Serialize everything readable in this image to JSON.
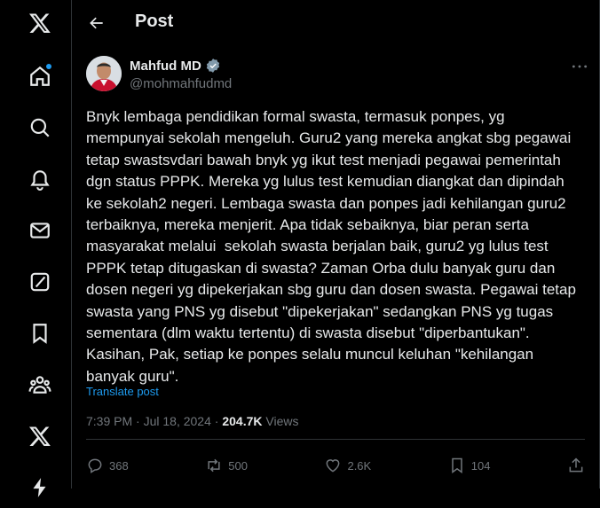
{
  "header": {
    "title": "Post"
  },
  "nav": [
    {
      "name": "x-logo-icon"
    },
    {
      "name": "home-icon"
    },
    {
      "name": "explore-icon"
    },
    {
      "name": "notifications-icon"
    },
    {
      "name": "messages-icon"
    },
    {
      "name": "grok-icon"
    },
    {
      "name": "bookmarks-icon"
    },
    {
      "name": "communities-icon"
    },
    {
      "name": "premium-icon"
    },
    {
      "name": "verified-orgs-icon"
    }
  ],
  "post": {
    "author_name": "Mahfud MD",
    "author_handle": "@mohmahfudmd",
    "text": "Bnyk lembaga pendidikan formal swasta, termasuk ponpes, yg mempunyai sekolah mengeluh. Guru2 yang mereka angkat sbg pegawai tetap swastsvdari bawah bnyk yg ikut test menjadi pegawai pemerintah dgn status PPPK. Mereka yg lulus test kemudian diangkat dan dipindah ke sekolah2 negeri. Lembaga swasta dan ponpes jadi kehilangan guru2 terbaiknya, mereka menjerit. Apa tidak sebaiknya, biar peran serta masyarakat melalui  sekolah swasta berjalan baik, guru2 yg lulus test PPPK tetap ditugaskan di swasta? Zaman Orba dulu banyak guru dan dosen negeri yg dipekerjakan sbg guru dan dosen swasta. Pegawai tetap swasta yang PNS yg disebut \"dipekerjakan\" sedangkan PNS yg tugas sementara (dlm waktu tertentu) di swasta disebut \"diperbantukan\". Kasihan, Pak, setiap ke ponpes selalu muncul keluhan \"kehilangan banyak guru\".",
    "translate_label": "Translate post",
    "time": "7:39 PM",
    "date": "Jul 18, 2024",
    "separator": "·",
    "views_count": "204.7K",
    "views_label": "Views"
  },
  "actions": {
    "replies": "368",
    "reposts": "500",
    "likes": "2.6K",
    "bookmarks": "104"
  },
  "colors": {
    "background": "#000000",
    "text": "#e7e9ea",
    "muted": "#71767b",
    "accent": "#1d9bf0",
    "border": "#2f3336"
  }
}
